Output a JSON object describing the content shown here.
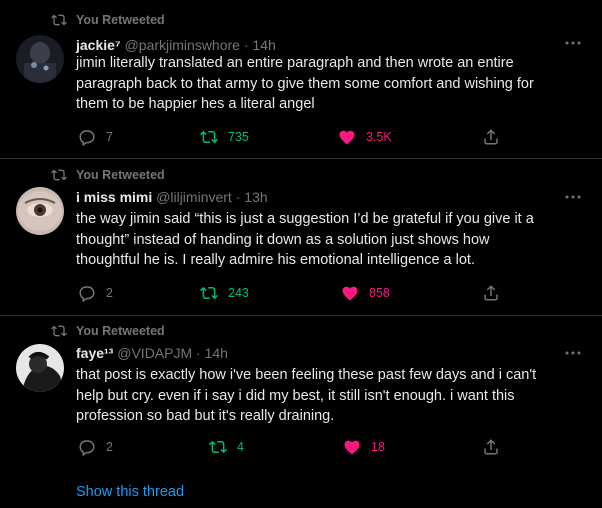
{
  "colors": {
    "accent": "#1d9bf0",
    "retweet_green": "#00ba7c",
    "like_pink": "#f91880",
    "muted": "#71767b"
  },
  "tweets": [
    {
      "retweet_label": "You Retweeted",
      "name": "jackie⁷",
      "handle": "@parkjiminswhore",
      "sep": "·",
      "time": "14h",
      "text_lines": [
        "jimin literally translated an entire paragraph and then wrote an entire",
        "paragraph back to that army to give them some comfort and wishing for",
        "them to be happier hes a literal angel"
      ],
      "replies": "7",
      "retweets": "735",
      "likes": "3.5K"
    },
    {
      "retweet_label": "You Retweeted",
      "name": "i miss mimi",
      "handle": "@liljiminvert",
      "sep": "·",
      "time": "13h",
      "text_lines": [
        "the way jimin said “this is just a suggestion I’d be grateful if you give it a",
        "thought” instead of handing it down as a solution just shows how",
        "thoughtful he is. I really admire his emotional intelligence a lot."
      ],
      "replies": "2",
      "retweets": "243",
      "likes": "858"
    },
    {
      "retweet_label": "You Retweeted",
      "name": "faye¹³",
      "handle": "@VIDAPJM",
      "sep": "·",
      "time": "14h",
      "text_lines": [
        "that post is exactly how i've been feeling these past few days and i can't",
        "help but cry. even if i say i did my best, it still isn't enough. i want this",
        "profession so bad but it's really draining."
      ],
      "replies": "2",
      "retweets": "4",
      "likes": "18"
    }
  ],
  "show_thread": "Show this thread"
}
